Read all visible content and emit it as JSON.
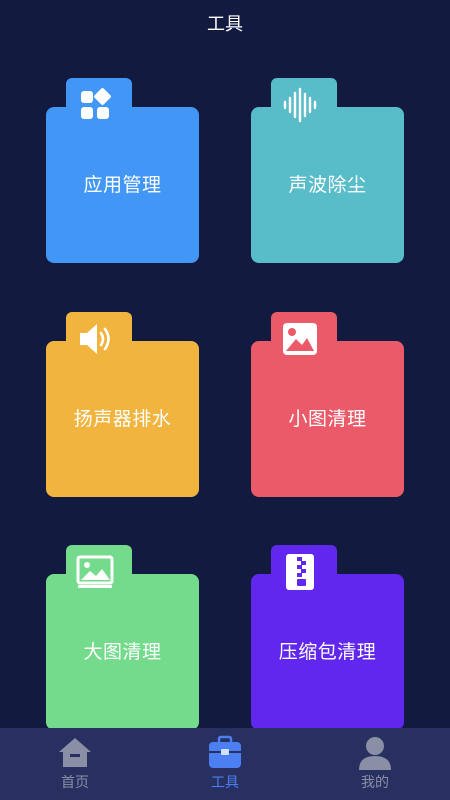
{
  "header": {
    "title": "工具"
  },
  "colors": {
    "background": "#131a40",
    "tabbar_background": "#273060",
    "tab_active": "#4b7ff2",
    "tab_inactive": "#8a8fa6"
  },
  "tools": [
    {
      "label": "应用管理",
      "icon": "app-grid-icon",
      "color": "#4196f6"
    },
    {
      "label": "声波除尘",
      "icon": "sound-wave-icon",
      "color": "#58bcc9"
    },
    {
      "label": "扬声器排水",
      "icon": "speaker-icon",
      "color": "#f1b43e"
    },
    {
      "label": "小图清理",
      "icon": "image-icon",
      "color": "#ea5a69"
    },
    {
      "label": "大图清理",
      "icon": "picture-icon",
      "color": "#74db8c"
    },
    {
      "label": "压缩包清理",
      "icon": "zip-icon",
      "color": "#6127ee"
    }
  ],
  "tabbar": {
    "items": [
      {
        "label": "首页",
        "icon": "home-icon",
        "active": false
      },
      {
        "label": "工具",
        "icon": "toolbox-icon",
        "active": true
      },
      {
        "label": "我的",
        "icon": "user-icon",
        "active": false
      }
    ]
  }
}
